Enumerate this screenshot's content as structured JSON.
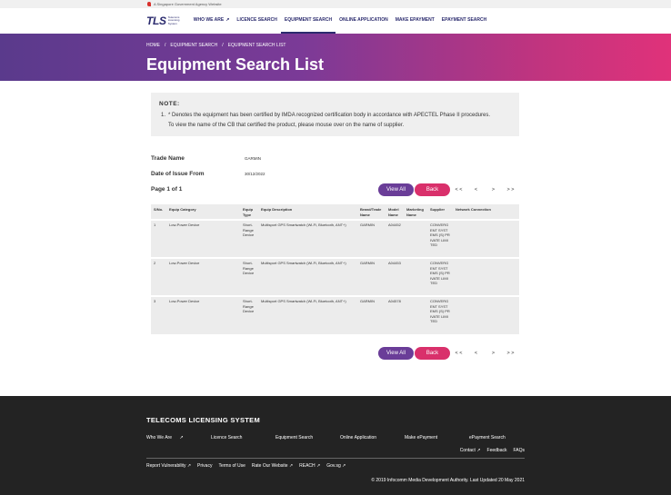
{
  "gov_bar": {
    "text": "A Singapore Government Agency Website"
  },
  "logo": {
    "abbr": "TLS",
    "sub": "Telecoms Licensing System"
  },
  "nav": {
    "items": [
      {
        "label": "WHO WE ARE",
        "external": "↗"
      },
      {
        "label": "LICENCE SEARCH"
      },
      {
        "label": "EQUIPMENT SEARCH"
      },
      {
        "label": "ONLINE APPLICATION"
      },
      {
        "label": "MAKE EPAYMENT"
      },
      {
        "label": "EPAYMENT SEARCH"
      }
    ]
  },
  "breadcrumb": {
    "home": "HOME",
    "sep": "/",
    "level1": "EQUIPMENT SEARCH",
    "level2": "EQUIPMENT SEARCH LIST"
  },
  "page_title": "Equipment Search List",
  "note": {
    "title": "NOTE:",
    "number": "1.",
    "line1": "* Denotes the equipment has been certified by IMDA recognized certification body in accordance with APECTEL Phase II procedures.",
    "line2": "To view the name of the CB that certified the product, please mouse over on the name of supplier."
  },
  "criteria": {
    "trade_name_label": "Trade Name",
    "trade_name_value": "GARMIN",
    "date_label": "Date of Issue From",
    "date_value": "30/12/2022"
  },
  "pager": {
    "page_info": "Page 1 of 1",
    "view_all": "View All",
    "back": "Back",
    "first": "< <",
    "prev": "<",
    "next": ">",
    "last": "> >"
  },
  "table": {
    "headers": {
      "sno": "S/No.",
      "category": "Equip Category",
      "type": "Equip Type",
      "description": "Equip Description",
      "brand": "Brand/Trade Name",
      "model": "Model Name",
      "marketing": "Marketing Name",
      "supplier": "Supplier",
      "network": "Network Connection"
    },
    "rows": [
      {
        "sno": "1",
        "category": "Low-Power Device",
        "type": "Short-Range Device",
        "description": "Multisport GPS Smartwatch (Wi-Fi, Bluetooth, ANT+)",
        "brand": "GARMIN",
        "model": "A04452",
        "marketing": "",
        "supplier": "CONVERGENT SYSTEMS (S) PRIVATE LIMITED",
        "network": ""
      },
      {
        "sno": "2",
        "category": "Low-Power Device",
        "type": "Short-Range Device",
        "description": "Multisport GPS Smartwatch (Wi-Fi, Bluetooth, ANT+)",
        "brand": "GARMIN",
        "model": "A04453",
        "marketing": "",
        "supplier": "CONVERGENT SYSTEMS (S) PRIVATE LIMITED",
        "network": ""
      },
      {
        "sno": "3",
        "category": "Low-Power Device",
        "type": "Short-Range Device",
        "description": "Multisport GPS Smartwatch (Wi-Fi, Bluetooth, ANT+)",
        "brand": "GARMIN",
        "model": "A04578",
        "marketing": "",
        "supplier": "CONVERGENT SYSTEMS (S) PRIVATE LIMITED",
        "network": ""
      }
    ]
  },
  "footer": {
    "title": "TELECOMS LICENSING SYSTEM",
    "links": [
      "Who We Are",
      "Licence Search",
      "Equipment Search",
      "Online Application",
      "Make ePayment",
      "ePayment Search"
    ],
    "links2": [
      "Contact",
      "Feedback",
      "FAQs"
    ],
    "legal": [
      "Report Vulnerability",
      "Privacy",
      "Terms of Use",
      "Rate Our Website",
      "REACH",
      "Gov.sg"
    ],
    "copyright": "© 2019 Infocomm Media Development Authority. Last Updated 20 May 2021"
  }
}
